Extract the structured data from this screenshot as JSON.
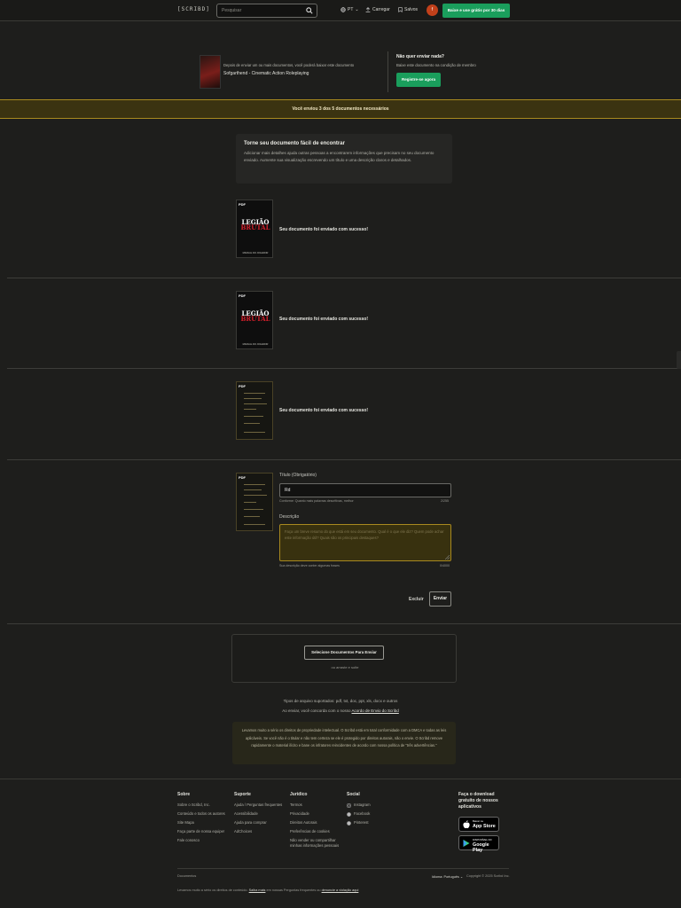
{
  "header": {
    "logo": "[SCRIBD]",
    "search_placeholder": "Pesquisar",
    "language": "PT",
    "upload_label": "Carregar",
    "saved_label": "Salvos",
    "avatar_letter": "f",
    "trial_label": "Baixe e use grátis por 30 dias"
  },
  "promo": {
    "small_text": "Depois de enviar um ou mais documentos, você poderá baixar este documento",
    "title": "Sofgarthend - Cinematic Action Roleplaying",
    "question": "Não quer enviar nada?",
    "subtitle": "Baixe este documento na condição de membro",
    "register_label": "Registre-se agora"
  },
  "banner_text": "Você enviou 3 dos 5 documentos necessários",
  "tip": {
    "title": "Torne seu documento fácil de encontrar",
    "body": "Adicionar mais detalhes ajuda outras pessoas a encontrarem informações que precisam no seu documento enviado. Aumente sua visualização escrevendo um título e uma descrição claros e detalhados."
  },
  "docs": [
    {
      "pdf": "PDF",
      "art_title_1": "LEGIÃO",
      "art_title_2": "BRUTAL",
      "art_foot": "MANUAL DO JOGADOR",
      "message": "Seu documento foi enviado com sucesso!"
    },
    {
      "pdf": "PDF",
      "art_title_1": "LEGIÃO",
      "art_title_2": "BRUTAL",
      "art_foot": "MANUAL DO JOGADOR",
      "message": "Seu documento foi enviado com sucesso!"
    },
    {
      "pdf": "PDF",
      "message": "Seu documento foi enviado com sucesso!"
    }
  ],
  "form": {
    "pdf": "PDF",
    "title_label": "Título (Obrigatório)",
    "title_value": "Rd",
    "title_hint": "Conforme: Quanto mais palavras descritivas, melhor",
    "title_count": "2/255",
    "desc_label": "Descrição",
    "desc_placeholder": "Faça um breve resumo do que está em seu documento. Qual é o que ele diz? Quem pode achar este informação útil? Quais são os principais destaques?",
    "desc_hint": "Sua descrição deve conter algumas frases",
    "desc_count": "0/4000",
    "cancel_label": "Excluir",
    "send_label": "Enviar"
  },
  "upload": {
    "select_label": "Selecione Documentos Para Enviar",
    "drop_text": "ou arraste e solte",
    "types_line": "Tipos de arquivo suportados: pdf, txt, doc, ppt, xls, docx e outros",
    "terms_prefix": "Ao enviar, você concorda com o nosso",
    "terms_link": "Acordo de Envio do Scribd",
    "copyright": "Levamos muito a sério os direitos de propriedade intelectual. O Scribd está em total conformidade com a DMCA e todas as leis aplicáveis. Se você não é o titular e não tem certeza se ele é protegido por direitos autorais, não o envie. O Scribd remove rapidamente o material ilícito e bane os infratores reincidentes de acordo com nossa política de \"três advertências.\""
  },
  "footer": {
    "cols": [
      {
        "title": "Sobre",
        "links": [
          "Sobre o Scribd, Inc.",
          "Conteúdo e todos os autores",
          "Site Mapa",
          "Faça parte de nossa equipe!",
          "Fale conosco"
        ]
      },
      {
        "title": "Suporte",
        "links": [
          "Ajuda / Perguntas frequentes",
          "Acessibilidade",
          "Ajuda para comprar",
          "AdChoices"
        ]
      },
      {
        "title": "Jurídico",
        "links": [
          "Termos",
          "Privacidade",
          "Direitos Autorais",
          "Preferências de cookies",
          "Não vender ou compartilhar minhas informações pessoais"
        ]
      },
      {
        "title": "Social",
        "links": [
          "Instagram",
          "Facebook",
          "Pinterest"
        ]
      }
    ],
    "apps_title": "Faça o download gratuito de nossos aplicativos",
    "app_store_small": "Baixar na",
    "app_store_big": "App Store",
    "play_small": "DISPONÍVEL NO",
    "play_big": "Google Play",
    "docs_link": "Documentos",
    "language": "Idioma: Português",
    "copyright": "Copyright © 2025 Scribd Inc.",
    "bottom_text": "Levamos muito a sério os direitos de conteúdo.",
    "bottom_link_1": "Saiba mais",
    "bottom_mid": "em nossas Perguntas frequentes ou",
    "bottom_link_2": "denuncie a violação aqui"
  }
}
